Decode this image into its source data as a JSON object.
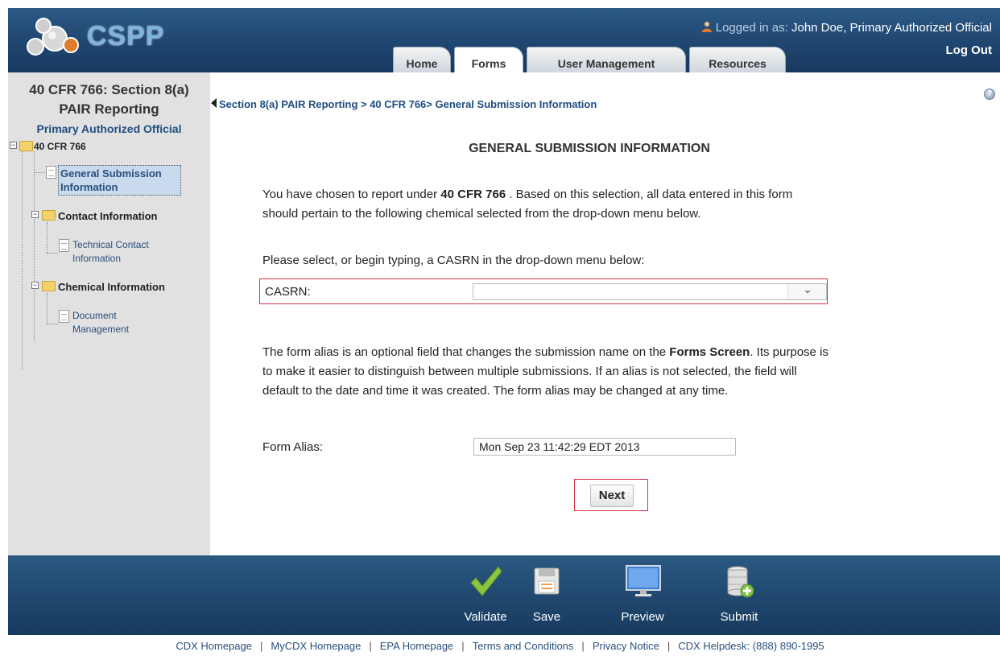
{
  "app": {
    "logo_text": "CSPP",
    "logged_in_label": "Logged in as:",
    "logged_in_user": "John Doe, Primary Authorized Official",
    "logout": "Log Out"
  },
  "tabs": [
    {
      "label": "Home",
      "active": false
    },
    {
      "label": "Forms",
      "active": true
    },
    {
      "label": "User Management",
      "active": false
    },
    {
      "label": "Resources",
      "active": false
    }
  ],
  "sidebar": {
    "title_line1": "40 CFR 766: Section 8(a)",
    "title_line2": "PAIR Reporting",
    "role": "Primary Authorized Official",
    "tree": {
      "root": "40 CFR 766",
      "general_line1": "General Submission",
      "general_line2": "Information",
      "contact": "Contact Information",
      "technical_line1": "Technical Contact",
      "technical_line2": "Information",
      "chemical": "Chemical Information",
      "document_line1": "Document",
      "document_line2": "Management"
    }
  },
  "main": {
    "breadcrumb": "Section 8(a) PAIR Reporting > 40 CFR 766> General Submission Information",
    "title": "GENERAL SUBMISSION INFORMATION",
    "intro_before": "You have chosen to report under ",
    "intro_bold": "40 CFR 766",
    "intro_after": " . Based on this selection, all data entered in this form",
    "intro_line2": "should pertain to the following chemical selected from the drop-down menu below.",
    "select_prompt": "Please select, or begin typing, a CASRN in the drop-down menu below:",
    "casrn_label": "CASRN:",
    "casrn_value": "",
    "alias_desc_before": "The form alias is an optional field that changes the submission name on the ",
    "alias_desc_bold": "Forms Screen",
    "alias_desc_after": ". Its purpose is",
    "alias_desc_line2": "to make it easier to distinguish between multiple submissions. If an alias is not selected, the field will",
    "alias_desc_line3": "default to the date and time it was created. The form alias may be changed at any time.",
    "alias_label": "Form Alias:",
    "alias_value": "Mon Sep 23 11:42:29 EDT 2013",
    "next": "Next"
  },
  "toolbar": {
    "validate": "Validate",
    "save": "Save",
    "preview": "Preview",
    "submit": "Submit"
  },
  "footer": {
    "links": [
      "CDX Homepage",
      "MyCDX Homepage",
      "EPA Homepage",
      "Terms and Conditions",
      "Privacy Notice",
      "CDX Helpdesk: (888) 890-1995"
    ]
  },
  "colors": {
    "header_blue": "#1f4670",
    "highlight_red": "#d9324a",
    "link_blue": "#1f4d80",
    "sidebar_gray": "#e1e1e1"
  }
}
